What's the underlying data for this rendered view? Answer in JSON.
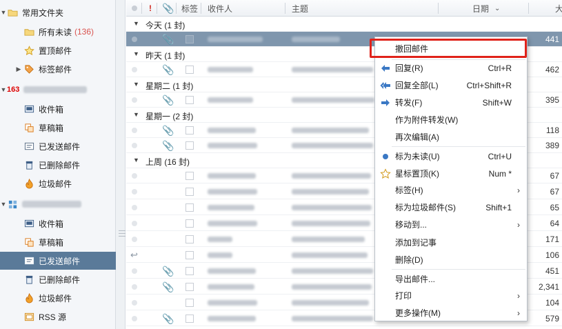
{
  "sidebar": {
    "common_folder": "常用文件夹",
    "all_unread": "所有未读",
    "all_unread_count": "(136)",
    "pinned": "置顶邮件",
    "tagged": "标签邮件",
    "account1_prefix": "163",
    "inbox": "收件箱",
    "drafts": "草稿箱",
    "sent": "已发送邮件",
    "deleted": "已删除邮件",
    "spam": "垃圾邮件",
    "inbox2": "收件箱",
    "drafts2": "草稿箱",
    "sent2": "已发送邮件",
    "deleted2": "已删除邮件",
    "spam2": "垃圾邮件",
    "rss": "RSS 源"
  },
  "list_header": {
    "flag": "!",
    "tags": "标签",
    "recipient": "收件人",
    "subject": "主题",
    "date": "日期",
    "size_abbr": "大"
  },
  "groups": {
    "today": "今天 (1 封)",
    "yesterday": "昨天 (1 封)",
    "tuesday": "星期二 (1 封)",
    "monday": "星期一 (2 封)",
    "lastweek": "上周 (16 封)"
  },
  "sizes": [
    "441",
    "462",
    "395",
    "118",
    "389",
    "67",
    "67",
    "65",
    "64",
    "171",
    "106",
    "451",
    "2,341",
    "104",
    "579"
  ],
  "menu": {
    "recall": "撤回邮件",
    "reply": "回复(R)",
    "reply_key": "Ctrl+R",
    "reply_all": "回复全部(L)",
    "reply_all_key": "Ctrl+Shift+R",
    "forward": "转发(F)",
    "forward_key": "Shift+W",
    "forward_attach": "作为附件转发(W)",
    "reedit": "再次编辑(A)",
    "mark_unread": "标为未读(U)",
    "mark_unread_key": "Ctrl+U",
    "star": "星标置顶(K)",
    "star_key": "Num *",
    "tags": "标签(H)",
    "mark_spam": "标为垃圾邮件(S)",
    "mark_spam_key": "Shift+1",
    "move": "移动到...",
    "add_note": "添加到记事",
    "delete": "删除(D)",
    "export": "导出邮件...",
    "print": "打印",
    "more": "更多操作(M)"
  },
  "colors": {
    "accent_red": "#e0221a",
    "selected_bg": "#5a7a99",
    "unread_count": "#d9534f"
  }
}
